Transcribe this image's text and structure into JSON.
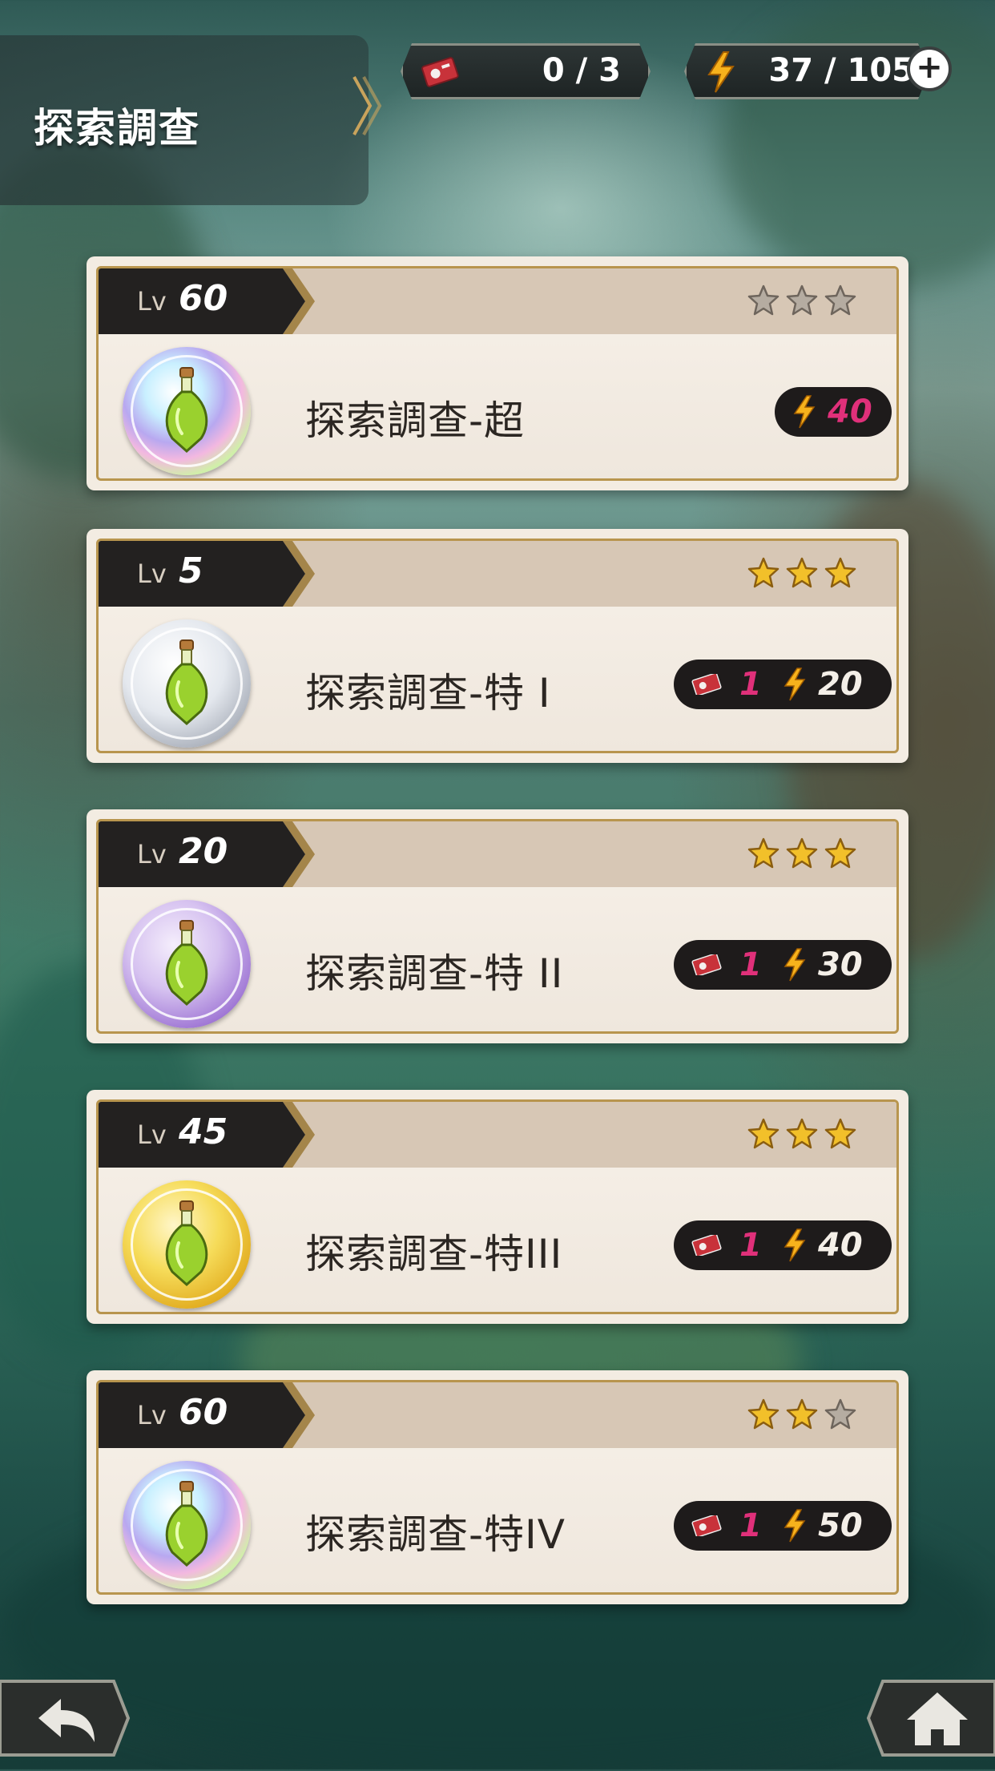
{
  "header": {
    "title": "探索調查",
    "tickets": "0 / 3",
    "stamina": "37 / 105",
    "plus_icon": "plus-icon"
  },
  "quests": [
    {
      "level_prefix": "Lv",
      "level": "60",
      "stars": 0,
      "name": "探索調查-超",
      "ticket_cost": null,
      "stamina_cost": "40",
      "icon": "rainbow-potion"
    },
    {
      "level_prefix": "Lv",
      "level": "5",
      "stars": 3,
      "name": "探索調查-特 I",
      "ticket_cost": "1",
      "stamina_cost": "20",
      "icon": "silver-potion"
    },
    {
      "level_prefix": "Lv",
      "level": "20",
      "stars": 3,
      "name": "探索調查-特 II",
      "ticket_cost": "1",
      "stamina_cost": "30",
      "icon": "purple-potion"
    },
    {
      "level_prefix": "Lv",
      "level": "45",
      "stars": 3,
      "name": "探索調查-特III",
      "ticket_cost": "1",
      "stamina_cost": "40",
      "icon": "gold-potion"
    },
    {
      "level_prefix": "Lv",
      "level": "60",
      "stars": 2,
      "name": "探索調查-特IV",
      "ticket_cost": "1",
      "stamina_cost": "50",
      "icon": "rainbow-potion"
    }
  ],
  "nav": {
    "back_icon": "back-arrow-icon",
    "home_icon": "home-icon"
  },
  "colors": {
    "cost_pink": "#e0307a",
    "star_gold": "#f2c02a",
    "card_border": "#b8954e"
  }
}
